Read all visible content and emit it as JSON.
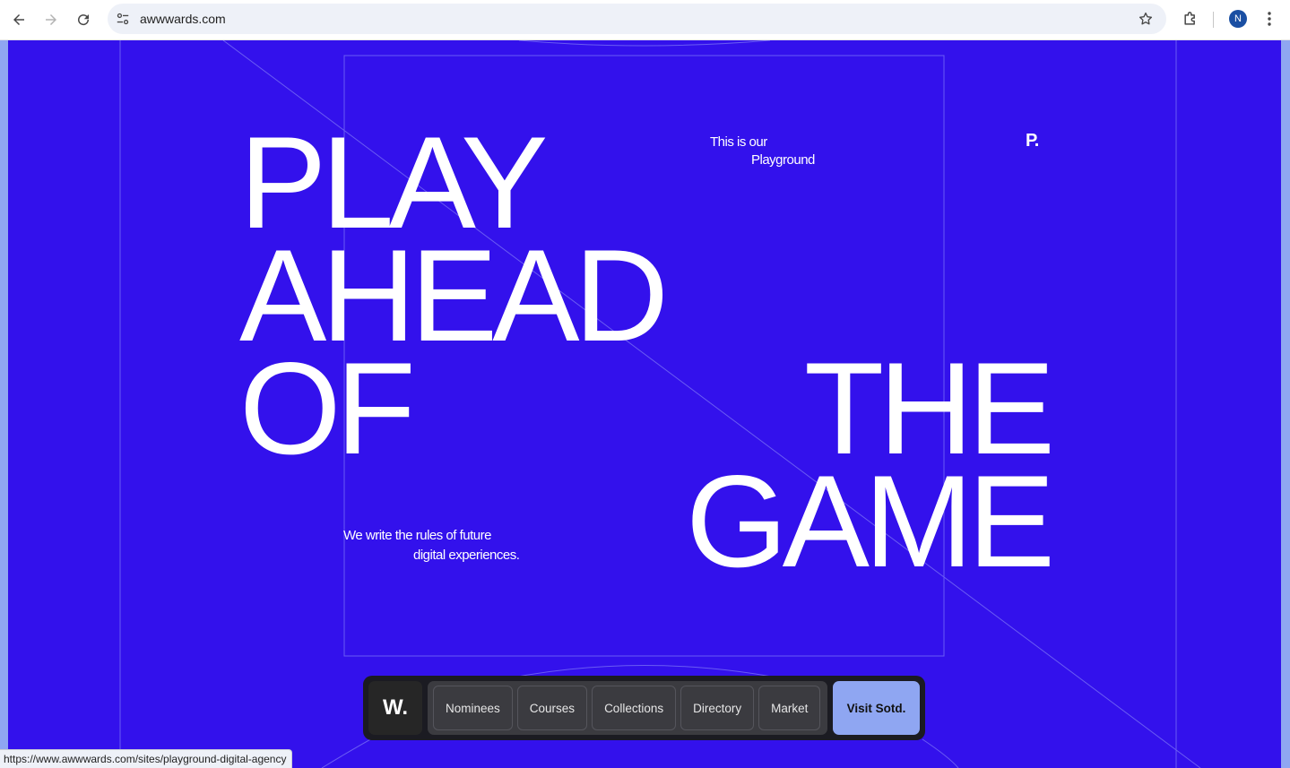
{
  "browser": {
    "url": "awwwards.com",
    "profile_initial": "N",
    "status_url": "https://www.awwwards.com/sites/playground-digital-agency"
  },
  "hero": {
    "headline_lines": [
      "PLAY",
      "AHEAD",
      "OF",
      "THE",
      "GAME"
    ],
    "tagline_top_line1": "This is our",
    "tagline_top_line2": "Playground",
    "tagline_bottom_line1": "We write the rules of future",
    "tagline_bottom_line2": "digital experiences.",
    "brand_logo": "P.",
    "background_color": "#3311ec"
  },
  "awwwards_bar": {
    "logo": "W.",
    "links": [
      "Nominees",
      "Courses",
      "Collections",
      "Directory",
      "Market"
    ],
    "cta_label": "Visit Sotd.",
    "cta_color": "#8fa6f2"
  }
}
